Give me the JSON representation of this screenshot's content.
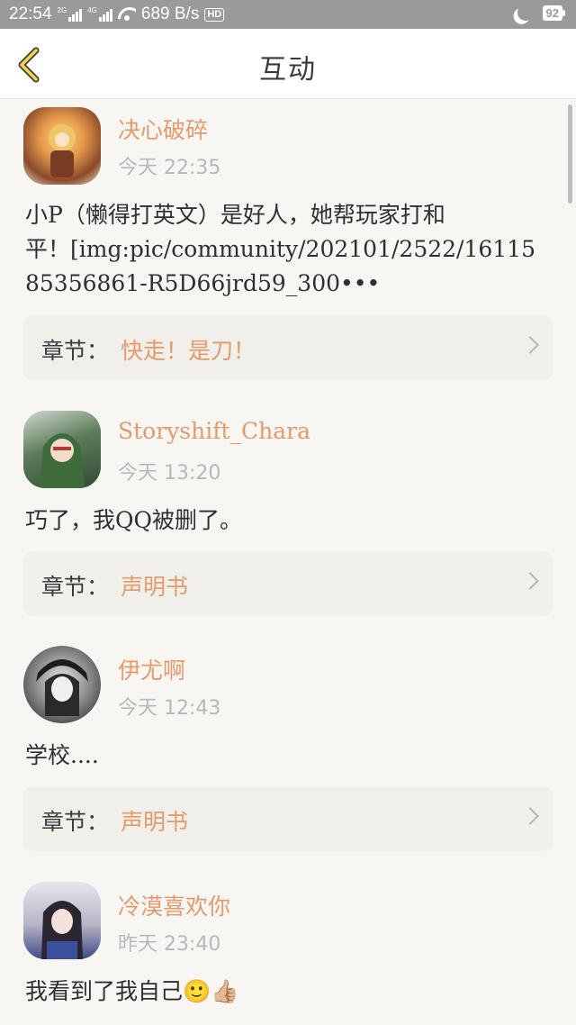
{
  "status_bar": {
    "time": "22:54",
    "net_tag_1": "2G",
    "net_tag_2": "4G",
    "speed": "689 B/s",
    "hd": "HD",
    "battery": "92"
  },
  "header": {
    "title": "互动"
  },
  "comments": [
    {
      "username": "决心破碎",
      "time": "今天 22:35",
      "body_lines": [
        "小P（懒得打英文）是好人，她帮玩家打和",
        "平！[img:pic/community/202101/2522/16115",
        "85356861-R5D66jrd59_300•••"
      ],
      "chapter_label": "章节：",
      "chapter_value": "快走！是刀！"
    },
    {
      "username": "Storyshift_Chara",
      "time": "今天 13:20",
      "body_lines": [
        "巧了，我QQ被删了。"
      ],
      "chapter_label": "章节：",
      "chapter_value": "声明书"
    },
    {
      "username": "伊尤啊",
      "time": "今天 12:43",
      "body_lines": [
        "学校...."
      ],
      "chapter_label": "章节：",
      "chapter_value": "声明书"
    },
    {
      "username": "冷漠喜欢你",
      "time": "昨天 23:40",
      "body_lines": [
        "我看到了我自己🙂👍🏼"
      ]
    }
  ]
}
